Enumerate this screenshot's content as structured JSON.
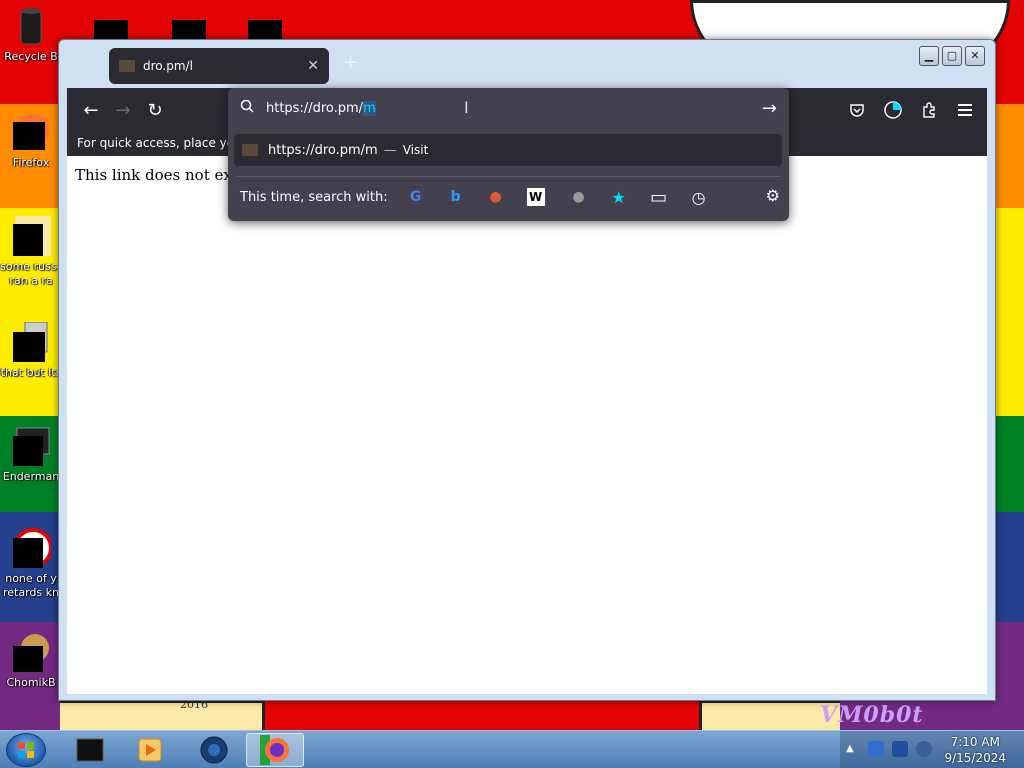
{
  "desktop": {
    "icons": [
      {
        "label": "Recycle B",
        "icon": "recycle-bin-icon"
      },
      {
        "label": "Firefox",
        "icon": "firefox-icon"
      },
      {
        "label": "some russ...",
        "label2": "ran a ra",
        "icon": "shortcut-icon"
      },
      {
        "label": "that but its",
        "icon": "folder-icon"
      },
      {
        "label": "Enderman",
        "icon": "terminal-icon"
      },
      {
        "label": "none of y",
        "label2": "retards kn",
        "icon": "media-icon"
      },
      {
        "label": "ChomikB",
        "icon": "hamster-icon"
      }
    ],
    "wallpaper_year": "2016",
    "wallpaper_watermark": "VM0b0t"
  },
  "browser": {
    "tab": {
      "title": "dro.pm/l",
      "close": "✕"
    },
    "new_tab": "+",
    "toolbar": {
      "back": "←",
      "forward": "→",
      "reload": "↻"
    },
    "bookmarks_hint": "For quick access, place your b",
    "page_text": "This link does not exist",
    "urlbar": {
      "typed": "https://dro.pm/",
      "autocomplete": "m",
      "go": "→",
      "result": {
        "url": "https://dro.pm/m",
        "sep": "—",
        "action": "Visit"
      },
      "search_with": "This time, search with:",
      "engines": [
        {
          "name": "google-icon",
          "glyph": "G",
          "color": "#4285f4"
        },
        {
          "name": "bing-icon",
          "glyph": "b",
          "color": "#2a9df4"
        },
        {
          "name": "duckduckgo-icon",
          "glyph": "●",
          "color": "#de5833"
        },
        {
          "name": "wikipedia-icon",
          "glyph": "W",
          "color": "#000000"
        },
        {
          "name": "search-engine-icon",
          "glyph": "●",
          "color": "#9a9a9a"
        },
        {
          "name": "bookmarks-star-icon",
          "glyph": "★",
          "color": "#00ddff"
        },
        {
          "name": "tabs-icon",
          "glyph": "▭",
          "color": "#fbfbfe"
        },
        {
          "name": "history-icon",
          "glyph": "◷",
          "color": "#fbfbfe"
        }
      ],
      "settings": "⚙"
    }
  },
  "taskbar": {
    "time": "7:10 AM",
    "date": "9/15/2024"
  }
}
